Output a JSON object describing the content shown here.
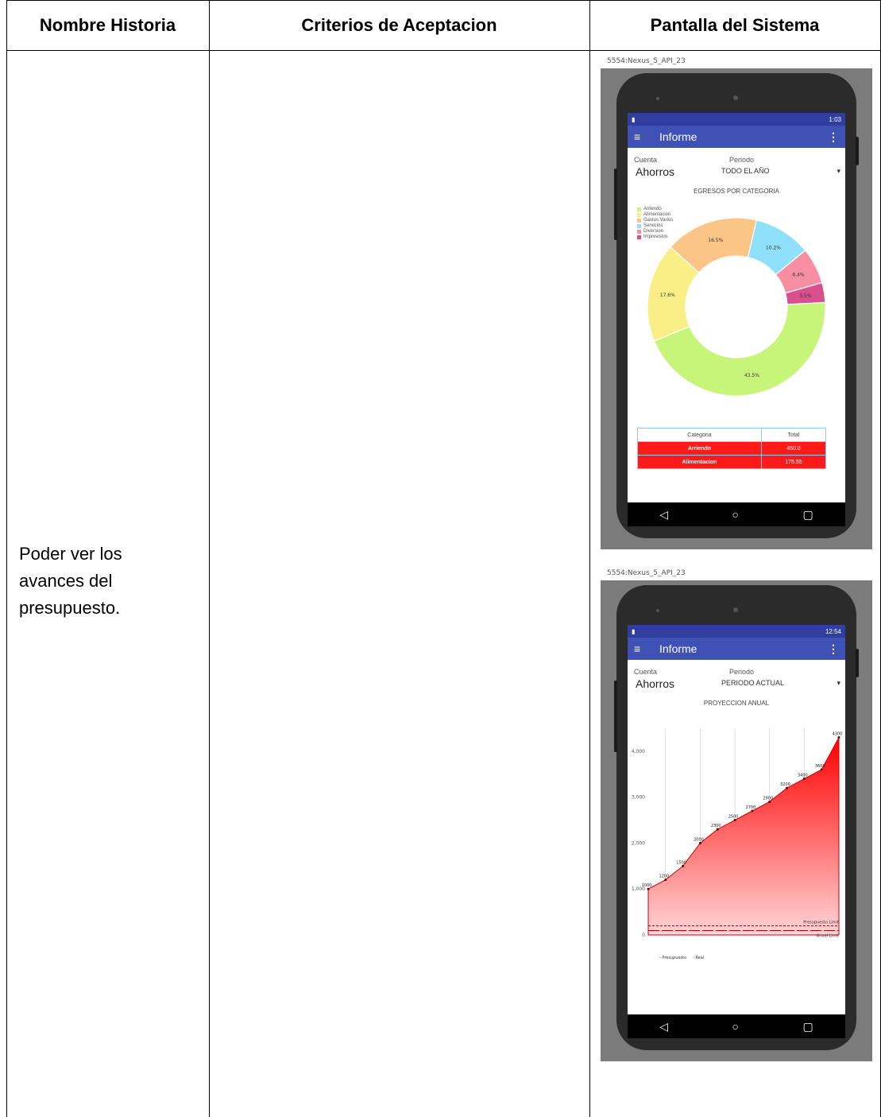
{
  "table": {
    "headers": [
      "Nombre Historia",
      "Criterios de Aceptacion",
      "Pantalla del Sistema"
    ],
    "story": [
      "Poder ver los",
      "avances del",
      "presupuesto."
    ],
    "criteria": ""
  },
  "screens": [
    {
      "device_label": "5554:Nexus_5_API_23",
      "time": "1:03",
      "app_title": "Informe",
      "cuenta_label": "Cuenta",
      "cuenta_value": "Ahorros",
      "periodo_label": "Periodo",
      "periodo_value": "TODO EL AÑO",
      "chart_title": "EGRESOS POR CATEGORIA",
      "table_headers": [
        "Categoria",
        "Total"
      ],
      "table_rows": [
        {
          "categoria": "Arriendo",
          "total": "450.0"
        },
        {
          "categoria": "Alimentacion",
          "total": "175.55"
        }
      ]
    },
    {
      "device_label": "5554:Nexus_5_API_23",
      "time": "12:54",
      "app_title": "Informe",
      "cuenta_label": "Cuenta",
      "cuenta_value": "Ahorros",
      "periodo_label": "Periodo",
      "periodo_value": "PERIODO ACTUAL",
      "chart_title": "PROYECCION ANUAL",
      "line_labels": [
        "Presupuesto Limit",
        "Anual Limit"
      ],
      "legend": [
        "Presupuesto",
        "Real"
      ]
    }
  ],
  "chart_data": [
    {
      "type": "pie",
      "title": "EGRESOS POR CATEGORIA",
      "categories": [
        "Arriendo",
        "Alimentacion",
        "Gastos Varios",
        "Servicios",
        "Diversion",
        "Imprevistos"
      ],
      "values": [
        43.5,
        17.6,
        16.5,
        10.2,
        6.4,
        3.5
      ],
      "colors": [
        "#c6f57a",
        "#f9ef86",
        "#fbc586",
        "#8fe0fb",
        "#f78ea1",
        "#d9508e"
      ],
      "legend_position": "top-left"
    },
    {
      "type": "area",
      "title": "PROYECCION ANUAL",
      "x": [
        1,
        2,
        3,
        4,
        5,
        6,
        7,
        8,
        9,
        10,
        11,
        12
      ],
      "series": [
        {
          "name": "Real",
          "values": [
            1000,
            1200,
            1500,
            2000,
            2300,
            2500,
            2700,
            2900,
            3200,
            3400,
            3600,
            4300
          ]
        },
        {
          "name": "Presupuesto",
          "values": [
            200,
            200,
            200,
            200,
            200,
            200,
            200,
            200,
            200,
            200,
            200,
            200
          ]
        }
      ],
      "y_ticks": [
        "0",
        "1,000",
        "2,000",
        "3,000",
        "4,000"
      ],
      "ylim": [
        0,
        4500
      ],
      "color": "#ff0000"
    }
  ]
}
